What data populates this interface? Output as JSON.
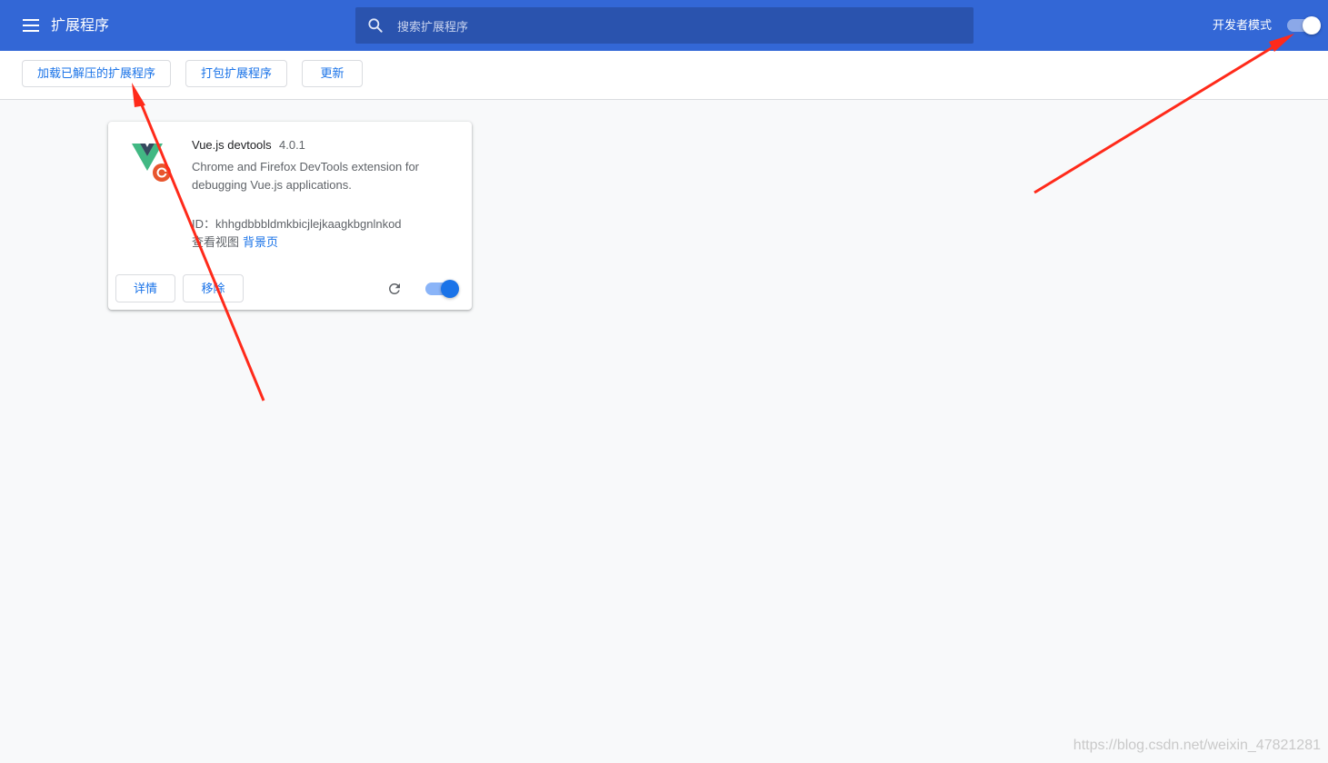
{
  "header": {
    "title": "扩展程序",
    "search_placeholder": "搜索扩展程序",
    "dev_mode_label": "开发者模式",
    "dev_mode_on": true
  },
  "toolbar": {
    "load_unpacked": "加载已解压的扩展程序",
    "pack": "打包扩展程序",
    "update": "更新"
  },
  "extension": {
    "name": "Vue.js devtools",
    "version": "4.0.1",
    "description": "Chrome and Firefox DevTools extension for debugging Vue.js applications.",
    "id_line": "ID：khhgdbbbldmkbicjlejkaagkbgnlnkod",
    "views_label": "查看视图",
    "views_link": "背景页",
    "details_button": "详情",
    "remove_button": "移除",
    "enabled": true
  },
  "colors": {
    "header_bg": "#3367d6",
    "accent": "#1a73e8",
    "arrow": "#ff2a1a"
  },
  "watermark": "https://blog.csdn.net/weixin_47821281"
}
